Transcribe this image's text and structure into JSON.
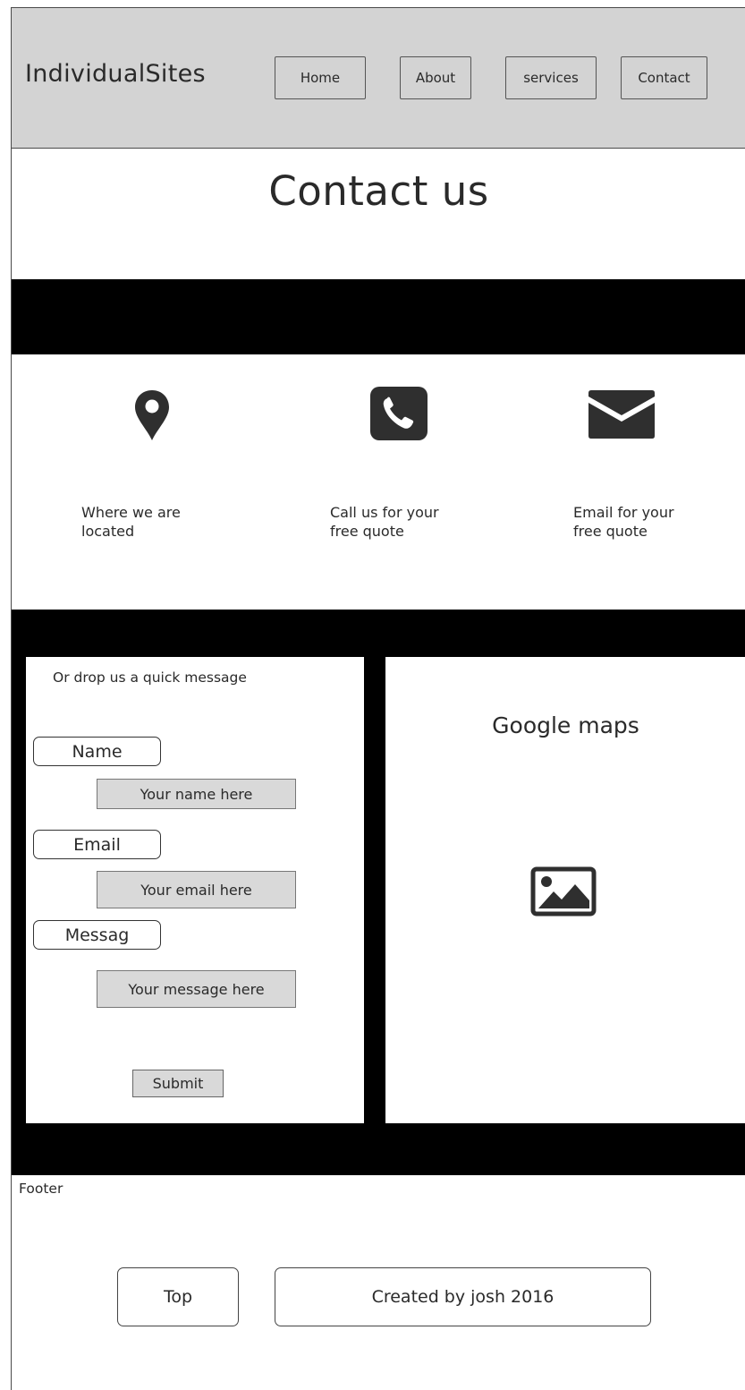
{
  "header": {
    "brand": "IndividualSites",
    "nav": [
      {
        "label": "Home"
      },
      {
        "label": "About"
      },
      {
        "label": "services"
      },
      {
        "label": "Contact"
      }
    ]
  },
  "page_title": "Contact us",
  "contact_methods": [
    {
      "icon": "map-pin-icon",
      "line1": "Where we are",
      "line2": "located"
    },
    {
      "icon": "phone-icon",
      "line1": "Call us for your",
      "line2": "free quote"
    },
    {
      "icon": "envelope-icon",
      "line1": "Email for your",
      "line2": "free quote"
    }
  ],
  "form": {
    "heading": "Or drop us a quick message",
    "name_label": "Name",
    "name_placeholder": "Your name here",
    "email_label": "Email",
    "email_placeholder": "Your email here",
    "message_label": "Messag",
    "message_placeholder": "Your message here",
    "submit_label": "Submit"
  },
  "map": {
    "title": "Google maps",
    "icon": "image-placeholder-icon"
  },
  "footer": {
    "label": "Footer",
    "top_button": "Top",
    "credit": "Created by josh 2016"
  },
  "colors": {
    "header_bg": "#d3d3d3",
    "band": "#000000",
    "input_bg": "#d9d9d9",
    "icon": "#2f2f2f"
  }
}
